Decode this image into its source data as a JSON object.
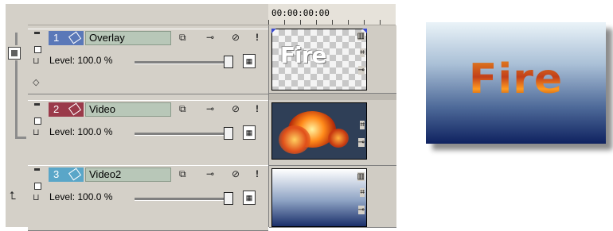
{
  "timeline": {
    "timecode": "00:00:00:00"
  },
  "tracks": [
    {
      "number": "1",
      "name": "Overlay",
      "level_text": "Level: 100.0 %",
      "level_value": 100.0,
      "badge_color": "#5a78b8",
      "thumbnail_text": "Fire"
    },
    {
      "number": "2",
      "name": "Video",
      "level_text": "Level: 100.0 %",
      "level_value": 100.0,
      "badge_color": "#9a3a4a"
    },
    {
      "number": "3",
      "name": "Video2",
      "level_text": "Level: 100.0 %",
      "level_value": 100.0,
      "badge_color": "#5aa6c8"
    }
  ],
  "header_icons": [
    "track-fx-icon",
    "automation-icon",
    "mute-icon",
    "solo-icon"
  ],
  "preview": {
    "text": "Fire"
  }
}
